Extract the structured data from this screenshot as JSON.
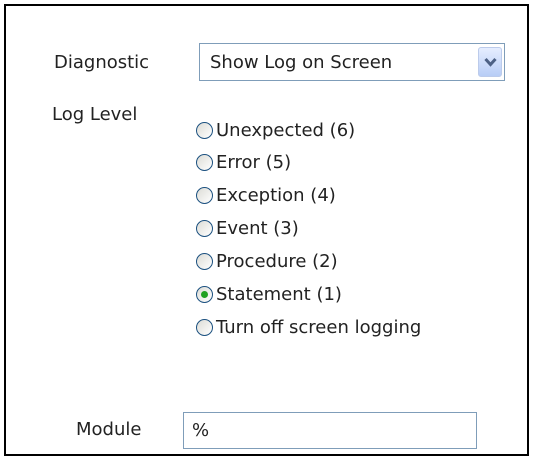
{
  "diagnostic": {
    "label": "Diagnostic",
    "selected": "Show Log on Screen",
    "dropdown_icon": "chevron-down-icon"
  },
  "log_level": {
    "label": "Log Level",
    "options": [
      {
        "label": "Unexpected (6)",
        "checked": false
      },
      {
        "label": "Error (5)",
        "checked": false
      },
      {
        "label": "Exception (4)",
        "checked": false
      },
      {
        "label": "Event (3)",
        "checked": false
      },
      {
        "label": "Procedure (2)",
        "checked": false
      },
      {
        "label": "Statement (1)",
        "checked": true
      },
      {
        "label": "Turn off screen logging",
        "checked": false
      }
    ]
  },
  "module": {
    "label": "Module",
    "value": "%"
  },
  "colors": {
    "border": "#000000",
    "field_border": "#7f9db9",
    "radio_checked": "#21a121",
    "radio_border": "#1c5180"
  }
}
